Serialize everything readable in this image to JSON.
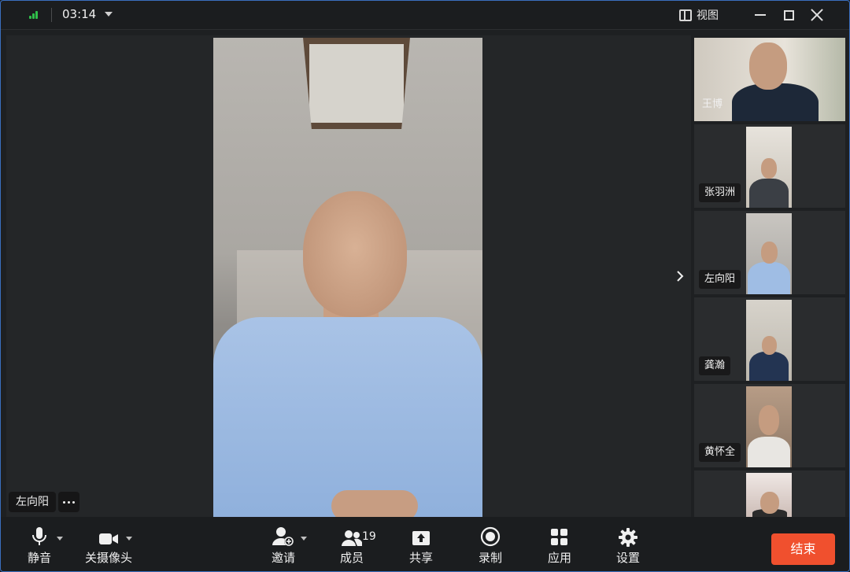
{
  "titlebar": {
    "time": "03:14",
    "view_label": "视图"
  },
  "colors": {
    "accent_end": "#f0502e",
    "signal_green": "#2fbf4a",
    "background": "#1e2022"
  },
  "icons": {
    "signal": "signal-strength-icon",
    "view": "view-layout-icon",
    "next": "chevron-right-icon"
  },
  "main": {
    "speaker_name": "左向阳"
  },
  "gallery": {
    "participants": [
      {
        "name": "王博"
      },
      {
        "name": "张羽洲"
      },
      {
        "name": "左向阳"
      },
      {
        "name": "龚瀚"
      },
      {
        "name": "黄怀全"
      }
    ]
  },
  "toolbar": {
    "mute_label": "静音",
    "camera_label": "关摄像头",
    "invite_label": "邀请",
    "members_label": "成员",
    "members_count": "19",
    "share_label": "共享",
    "record_label": "录制",
    "apps_label": "应用",
    "settings_label": "设置",
    "end_label": "结束"
  }
}
